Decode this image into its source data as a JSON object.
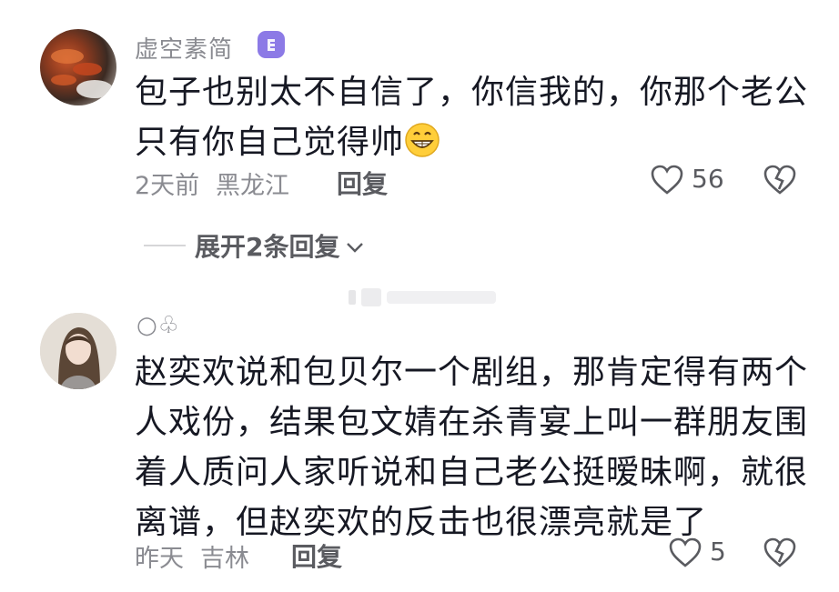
{
  "comments": [
    {
      "username": "虚空素简",
      "badge_icon": "level-badge-icon",
      "text_lines": [
        "包子也别太不自信了，你信我的，你那个老公",
        "只有你自己觉得帅"
      ],
      "emoji": "grinning-face-icon",
      "time": "2天前",
      "location": "黑龙江",
      "reply_label": "回复",
      "like_count": "56"
    },
    {
      "username": "○♧",
      "text_lines": [
        "赵奕欢说和包贝尔一个剧组，那肯定得有两个",
        "人戏份，结果包文婧在杀青宴上叫一群朋友围",
        "着人质问人家听说和自己老公挺暧昧啊，就很",
        "离谱，但赵奕欢的反击也很漂亮就是了"
      ],
      "time": "昨天",
      "location": "吉林",
      "reply_label": "回复",
      "like_count": "5"
    }
  ],
  "expand_replies_label": "展开2条回复",
  "colors": {
    "text": "#161823",
    "secondary": "#8a8b91",
    "badge": "#8c7ae6"
  }
}
